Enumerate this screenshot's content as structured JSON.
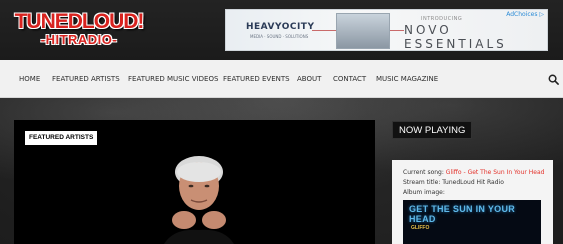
{
  "logo": {
    "top": "TUNEDLOUD!",
    "bottom": "-HITRADIO-"
  },
  "ad": {
    "brand": "HEAVYOCITY",
    "brand_sub": "MEDIA · SOUND · SOLUTIONS",
    "intro": "INTRODUCING",
    "product": "NOVO ESSENTIALS",
    "choices": "AdChoices ▷"
  },
  "nav": {
    "items": [
      {
        "label": "HOME"
      },
      {
        "label": "FEATURED ARTISTS"
      },
      {
        "label": "FEATURED MUSIC VIDEOS"
      },
      {
        "label": "FEATURED EVENTS"
      },
      {
        "label": "ABOUT"
      },
      {
        "label": "CONTACT"
      },
      {
        "label": "MUSIC MAGAZINE"
      }
    ],
    "search_icon": "search-icon"
  },
  "featured": {
    "label": "FEATURED ARTISTS"
  },
  "now_playing": {
    "label": "NOW PLAYING",
    "current_song_label": "Current song:",
    "current_song": "Gliffo - Get The Sun In Your Head",
    "stream_title": "Stream title: TunedLoud Hit Radio",
    "album_image_label": "Album image:",
    "album_title": "GET THE SUN IN YOUR HEAD",
    "album_artist": "GLIFFO"
  },
  "colors": {
    "accent": "#d8231f",
    "song": "#e3322b",
    "album_text": "#5fb8e8"
  }
}
